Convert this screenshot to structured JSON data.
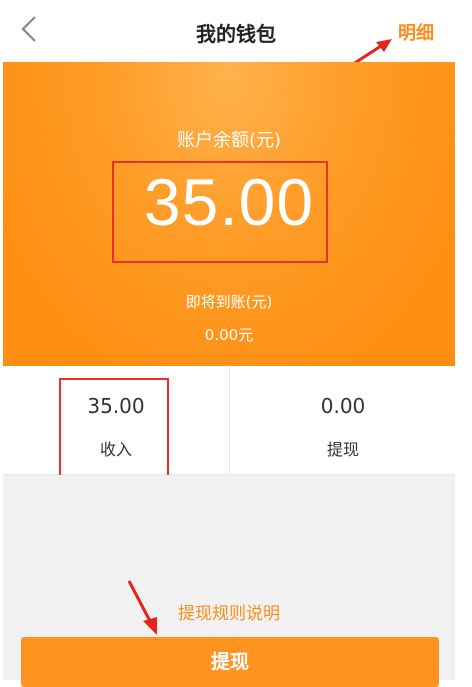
{
  "header": {
    "title": "我的钱包",
    "detail_label": "明细"
  },
  "balance": {
    "label": "账户余额(元)",
    "value": "35.00",
    "pending_label": "即将到账(元)",
    "pending_value": "0.00元"
  },
  "stats": {
    "income": {
      "value": "35.00",
      "label": "收入"
    },
    "withdraw": {
      "value": "0.00",
      "label": "提现"
    }
  },
  "rules_label": "提现规则说明",
  "withdraw_button_label": "提现",
  "colors": {
    "accent": "#ff9220",
    "highlight_box": "#e8322a",
    "annotation_arrow": "#e8211a"
  }
}
